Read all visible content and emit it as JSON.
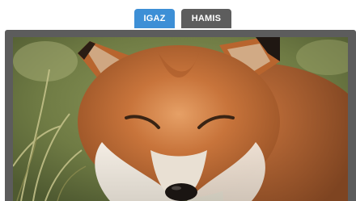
{
  "tabs": [
    {
      "label": "IGAZ",
      "active": true
    },
    {
      "label": "HAMIS",
      "active": false
    }
  ],
  "image": {
    "subject": "fox-face-photo"
  },
  "colors": {
    "active_tab": "#3d8fd6",
    "inactive_tab": "#5d5d5d",
    "frame": "#5c5c5c"
  }
}
